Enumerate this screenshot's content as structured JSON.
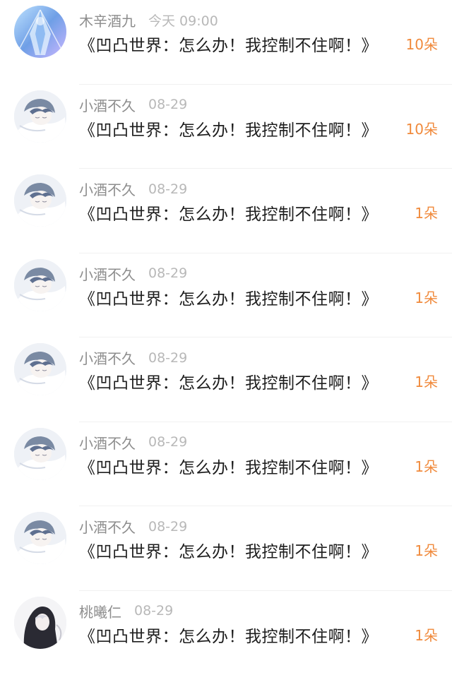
{
  "colors": {
    "name": "#8d8d8d",
    "time": "#b8b8b8",
    "title": "#1e1e1e",
    "count_accent": "#f08a3c",
    "divider": "#f1f1f1"
  },
  "gifts": [
    {
      "avatar": "crystal-figure-avatar",
      "user": "木辛酒九",
      "time": "今天 09:00",
      "work": "《凹凸世界：怎么办！我控制不住啊！》",
      "count": "10朵"
    },
    {
      "avatar": "anime-sleeping-boy-avatar",
      "user": "小酒不久",
      "time": "08-29",
      "work": "《凹凸世界：怎么办！我控制不住啊！》",
      "count": "10朵"
    },
    {
      "avatar": "anime-sleeping-boy-avatar",
      "user": "小酒不久",
      "time": "08-29",
      "work": "《凹凸世界：怎么办！我控制不住啊！》",
      "count": "1朵"
    },
    {
      "avatar": "anime-sleeping-boy-avatar",
      "user": "小酒不久",
      "time": "08-29",
      "work": "《凹凸世界：怎么办！我控制不住啊！》",
      "count": "1朵"
    },
    {
      "avatar": "anime-sleeping-boy-avatar",
      "user": "小酒不久",
      "time": "08-29",
      "work": "《凹凸世界：怎么办！我控制不住啊！》",
      "count": "1朵"
    },
    {
      "avatar": "anime-sleeping-boy-avatar",
      "user": "小酒不久",
      "time": "08-29",
      "work": "《凹凸世界：怎么办！我控制不住啊！》",
      "count": "1朵"
    },
    {
      "avatar": "anime-sleeping-boy-avatar",
      "user": "小酒不久",
      "time": "08-29",
      "work": "《凹凸世界：怎么办！我控制不住啊！》",
      "count": "1朵"
    },
    {
      "avatar": "hooded-figure-avatar",
      "user": "桃曦仁",
      "time": "08-29",
      "work": "《凹凸世界：怎么办！我控制不住啊！》",
      "count": "1朵"
    }
  ]
}
